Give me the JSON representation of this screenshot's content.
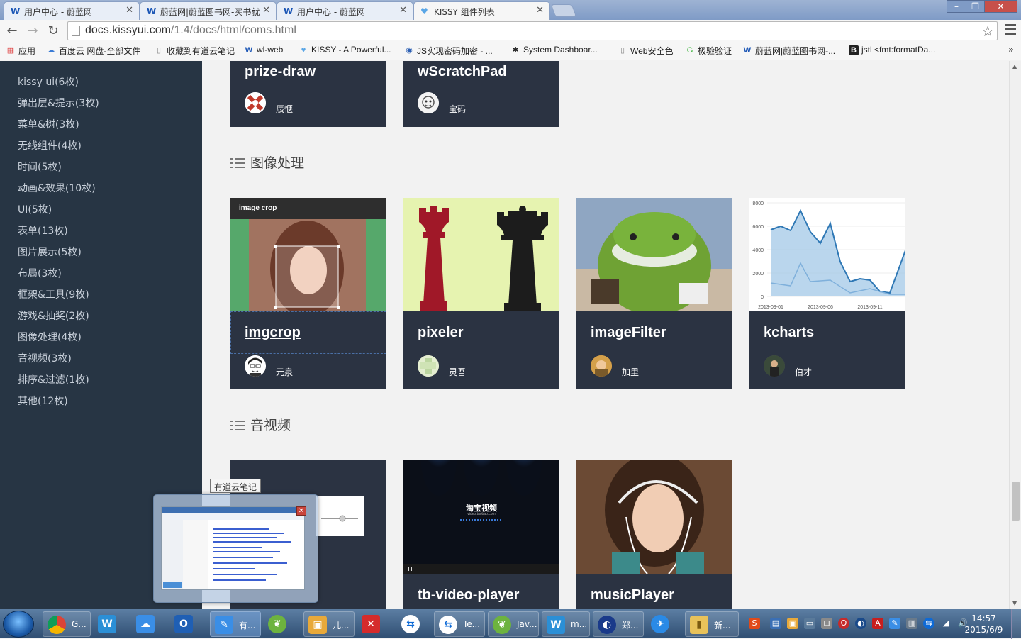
{
  "browser": {
    "tabs": [
      {
        "label": "用户中心 - 蔚蓝网",
        "icon": "wl-icon"
      },
      {
        "label": "蔚蓝网|蔚蓝图书网-买书就",
        "icon": "wl-icon"
      },
      {
        "label": "用户中心 - 蔚蓝网",
        "icon": "wl-icon"
      },
      {
        "label": "KISSY 组件列表",
        "icon": "kissy-heart-icon"
      }
    ],
    "url_host": "docs.kissyui.com",
    "url_path": "/1.4/docs/html/coms.html",
    "bookmarks": [
      {
        "label": "应用",
        "icon": "apps-grid-icon"
      },
      {
        "label": "百度云 网盘-全部文件",
        "icon": "baidu-cloud-icon"
      },
      {
        "label": "收藏到有道云笔记",
        "icon": "page-icon"
      },
      {
        "label": "wl-web",
        "icon": "wl-icon"
      },
      {
        "label": "KISSY - A Powerful...",
        "icon": "kissy-heart-icon"
      },
      {
        "label": "JS实现密码加密 - ...",
        "icon": "globe-icon"
      },
      {
        "label": "System Dashboar...",
        "icon": "jenkins-icon"
      },
      {
        "label": "Web安全色",
        "icon": "page-icon"
      },
      {
        "label": "极验验证",
        "icon": "geetest-icon"
      },
      {
        "label": "蔚蓝网|蔚蓝图书网-...",
        "icon": "wl-icon"
      },
      {
        "label": "jstl <fmt:formatDa...",
        "icon": "bootstrap-icon"
      }
    ],
    "more": "»"
  },
  "sidebar": {
    "items": [
      "kissy ui(6枚)",
      "弹出层&提示(3枚)",
      "菜单&树(3枚)",
      "无线组件(4枚)",
      "时间(5枚)",
      "动画&效果(10枚)",
      "UI(5枚)",
      "表单(13枚)",
      "图片展示(5枚)",
      "布局(3枚)",
      "框架&工具(9枚)",
      "游戏&抽奖(2枚)",
      "图像处理(4枚)",
      "音视频(3枚)",
      "排序&过滤(1枚)",
      "其他(12枚)"
    ]
  },
  "sections": {
    "top_cards": [
      {
        "title": "prize-draw",
        "author": "辰惬"
      },
      {
        "title": "wScratchPad",
        "author": "宝码"
      }
    ],
    "image": {
      "heading": "图像处理",
      "cards": [
        {
          "title": "imgcrop",
          "author": "元泉",
          "thumb_caption": "image crop"
        },
        {
          "title": "pixeler",
          "author": "灵吾"
        },
        {
          "title": "imageFilter",
          "author": "加里"
        },
        {
          "title": "kcharts",
          "author": "伯才"
        }
      ]
    },
    "av": {
      "heading": "音视频",
      "cards": [
        {
          "title": ""
        },
        {
          "title": "tb-video-player",
          "thumb_text": "淘宝视频",
          "thumb_sub": "video.taobao.com"
        },
        {
          "title": "musicPlayer"
        }
      ]
    }
  },
  "kcharts_thumb": {
    "y_ticks": [
      "8000",
      "6000",
      "4000",
      "2000",
      "0"
    ],
    "x_ticks": [
      "2013-09-01",
      "2013-09-06",
      "2013-09-11"
    ]
  },
  "taskbar": {
    "items": [
      {
        "label": "G...",
        "icon": "chrome-icon"
      },
      {
        "label": "",
        "icon": "webstorm-icon"
      },
      {
        "label": "",
        "icon": "baidu-cloud-icon"
      },
      {
        "label": "",
        "icon": "outlook-icon"
      },
      {
        "label": "有...",
        "icon": "youdao-note-icon"
      },
      {
        "label": "",
        "icon": "spring-leaf-icon"
      },
      {
        "label": "儿...",
        "icon": "box-icon"
      },
      {
        "label": "",
        "icon": "xmind-icon"
      },
      {
        "label": "",
        "icon": "teamviewer-icon"
      },
      {
        "label": "Te...",
        "icon": "teamviewer-icon"
      },
      {
        "label": "Jav...",
        "icon": "spring-leaf-icon"
      },
      {
        "label": "m...",
        "icon": "webstorm-icon"
      },
      {
        "label": "郑...",
        "icon": "orb-icon"
      },
      {
        "label": "",
        "icon": "safari-icon"
      },
      {
        "label": "新...",
        "icon": "folder-icon"
      }
    ],
    "time": "14:57",
    "date": "2015/6/9"
  },
  "tooltip": "有道云笔记",
  "colors": {
    "sidebar_bg": "#273544",
    "card_bg": "#2b3342",
    "content_bg": "#f2f2f2",
    "pixeler_bg": "#e6f3b0"
  }
}
